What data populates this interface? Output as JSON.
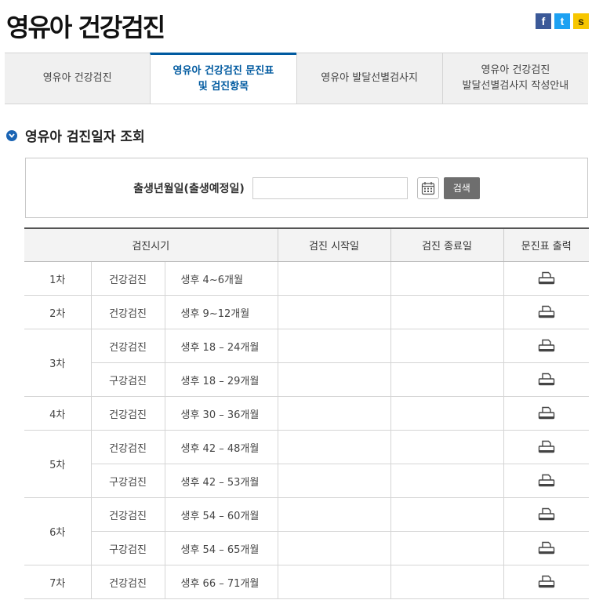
{
  "header": {
    "title": "영유아 건강검진"
  },
  "social": {
    "facebook": "f",
    "twitter": "t",
    "kakao": "s"
  },
  "tabs": [
    {
      "label": "영유아 건강검진",
      "active": false
    },
    {
      "label": "영유아 건강검진 문진표\n및 검진항목",
      "active": true
    },
    {
      "label": "영유아 발달선별검사지",
      "active": false
    },
    {
      "label": "영유아 건강검진\n발달선별검사지 작성안내",
      "active": false
    }
  ],
  "section": {
    "title": "영유아 검진일자 조회"
  },
  "search": {
    "label": "출생년월일(출생예정일)",
    "value": "",
    "placeholder": "",
    "button": "검색"
  },
  "table": {
    "headers": [
      "검진시기",
      "검진 시작일",
      "검진 종료일",
      "문진표 출력"
    ],
    "rows": [
      {
        "round": "1차",
        "rowspan": 1,
        "type": "건강검진",
        "age": "생후 4~6개월"
      },
      {
        "round": "2차",
        "rowspan": 1,
        "type": "건강검진",
        "age": "생후 9~12개월"
      },
      {
        "round": "3차",
        "rowspan": 2,
        "type": "건강검진",
        "age": "생후 18 – 24개월"
      },
      {
        "type": "구강검진",
        "age": "생후 18 – 29개월"
      },
      {
        "round": "4차",
        "rowspan": 1,
        "type": "건강검진",
        "age": "생후 30 – 36개월"
      },
      {
        "round": "5차",
        "rowspan": 2,
        "type": "건강검진",
        "age": "생후 42 – 48개월"
      },
      {
        "type": "구강검진",
        "age": "생후 42 – 53개월"
      },
      {
        "round": "6차",
        "rowspan": 2,
        "type": "건강검진",
        "age": "생후 54 – 60개월"
      },
      {
        "type": "구강검진",
        "age": "생후 54 – 65개월"
      },
      {
        "round": "7차",
        "rowspan": 1,
        "type": "건강검진",
        "age": "생후 66 – 71개월"
      }
    ]
  },
  "colors": {
    "accent": "#005aa0",
    "section_icon": "#1a64b4",
    "button": "#6e6e6e"
  },
  "icons": {
    "section": "chevron-down-circle-icon",
    "calendar": "calendar-icon",
    "print": "printer-icon"
  }
}
